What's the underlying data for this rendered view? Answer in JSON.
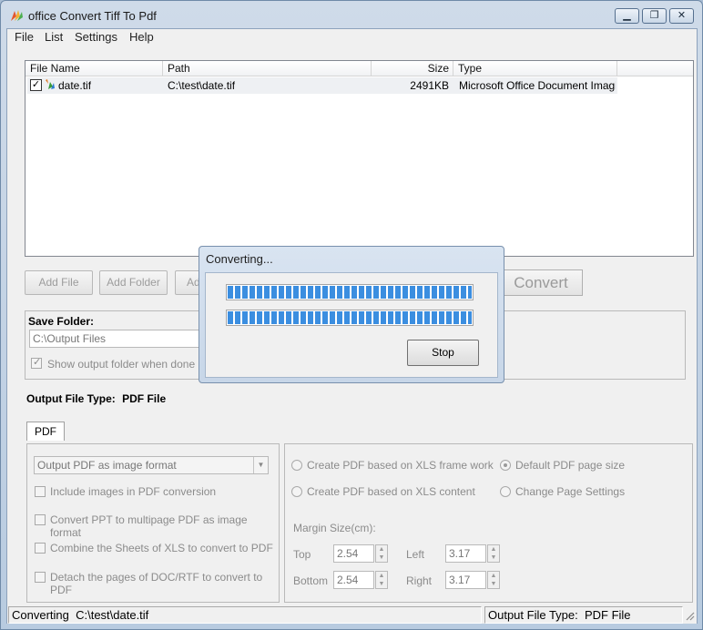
{
  "window": {
    "title": "office Convert Tiff To Pdf",
    "minimize": "▁",
    "maximize": "❐",
    "close": "✕"
  },
  "menu": [
    "File",
    "List",
    "Settings",
    "Help"
  ],
  "list": {
    "columns": [
      "File Name",
      "Path",
      "Size",
      "Type"
    ],
    "rows": [
      {
        "checked": true,
        "name": "date.tif",
        "path": "C:\\test\\date.tif",
        "size": "2491KB",
        "type": "Microsoft Office Document Imagi..."
      }
    ]
  },
  "buttons": {
    "add_file": "Add File",
    "add_folder": "Add Folder",
    "add_other": "Ad",
    "convert": "Convert"
  },
  "save": {
    "label": "Save Folder:",
    "path": "C:\\Output Files",
    "show_when_done": "Show output folder when done"
  },
  "output_type": {
    "label": "Output File Type:",
    "value": "PDF File"
  },
  "tab": {
    "label": "PDF"
  },
  "options_left": {
    "format_select": "Output PDF as image format",
    "checks": [
      "Include images in PDF conversion",
      "Convert PPT to multipage PDF as image format",
      "Combine the Sheets of XLS to convert to PDF",
      "Detach the pages of DOC/RTF to convert to PDF"
    ]
  },
  "options_right": {
    "radio_xls_frame": "Create PDF based on XLS frame work",
    "radio_xls_content": "Create PDF based on XLS content",
    "radio_default_size": "Default PDF page size",
    "radio_change_page": "Change Page Settings",
    "margin_label": "Margin Size(cm):",
    "top_label": "Top",
    "top_value": "2.54",
    "bottom_label": "Bottom",
    "bottom_value": "2.54",
    "left_label": "Left",
    "left_value": "3.17",
    "right_label": "Right",
    "right_value": "3.17"
  },
  "status": {
    "left": "Converting  C:\\test\\date.tif",
    "right": "Output File Type:  PDF File"
  },
  "dialog": {
    "title": "Converting...",
    "progress1": 1.0,
    "progress2": 1.0,
    "stop": "Stop"
  },
  "colors": {
    "progress_fill": "#3b8ee0",
    "title_bar": "#b8cbe0"
  }
}
